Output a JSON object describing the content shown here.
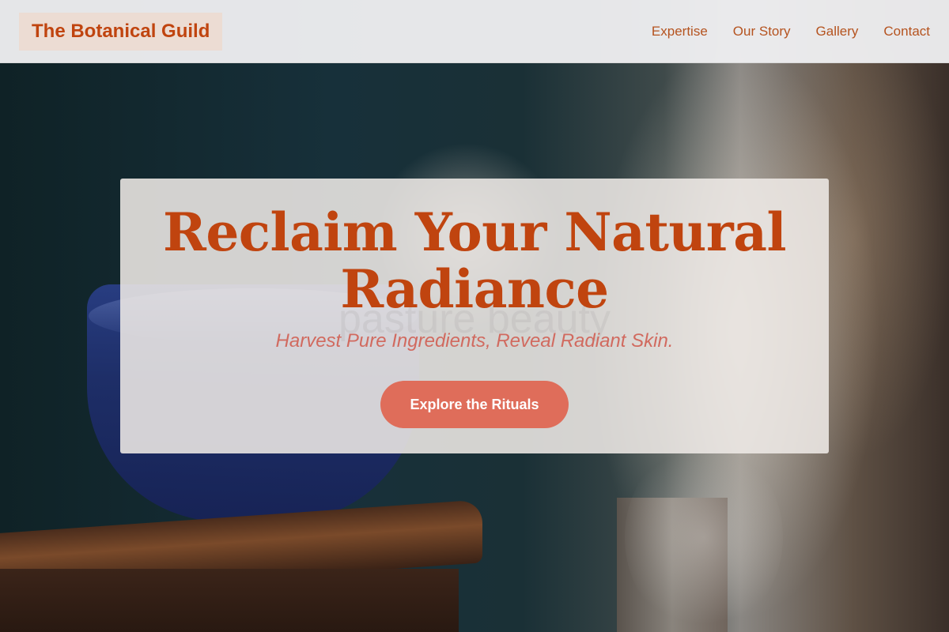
{
  "header": {
    "brand": "The Botanical Guild",
    "nav": [
      {
        "label": "Expertise"
      },
      {
        "label": "Our Story"
      },
      {
        "label": "Gallery"
      },
      {
        "label": "Contact"
      }
    ]
  },
  "hero": {
    "headline": "Reclaim Your Natural Radiance",
    "subtitle": "Harvest Pure Ingredients, Reveal Radiant Skin.",
    "cta_label": "Explore the Rituals",
    "watermark": "pasture beauty"
  },
  "colors": {
    "accent": "#c0440f",
    "cta_bg": "#df6d5a",
    "subtitle": "#d16a5f",
    "brand_bg": "#ecdcd3"
  }
}
